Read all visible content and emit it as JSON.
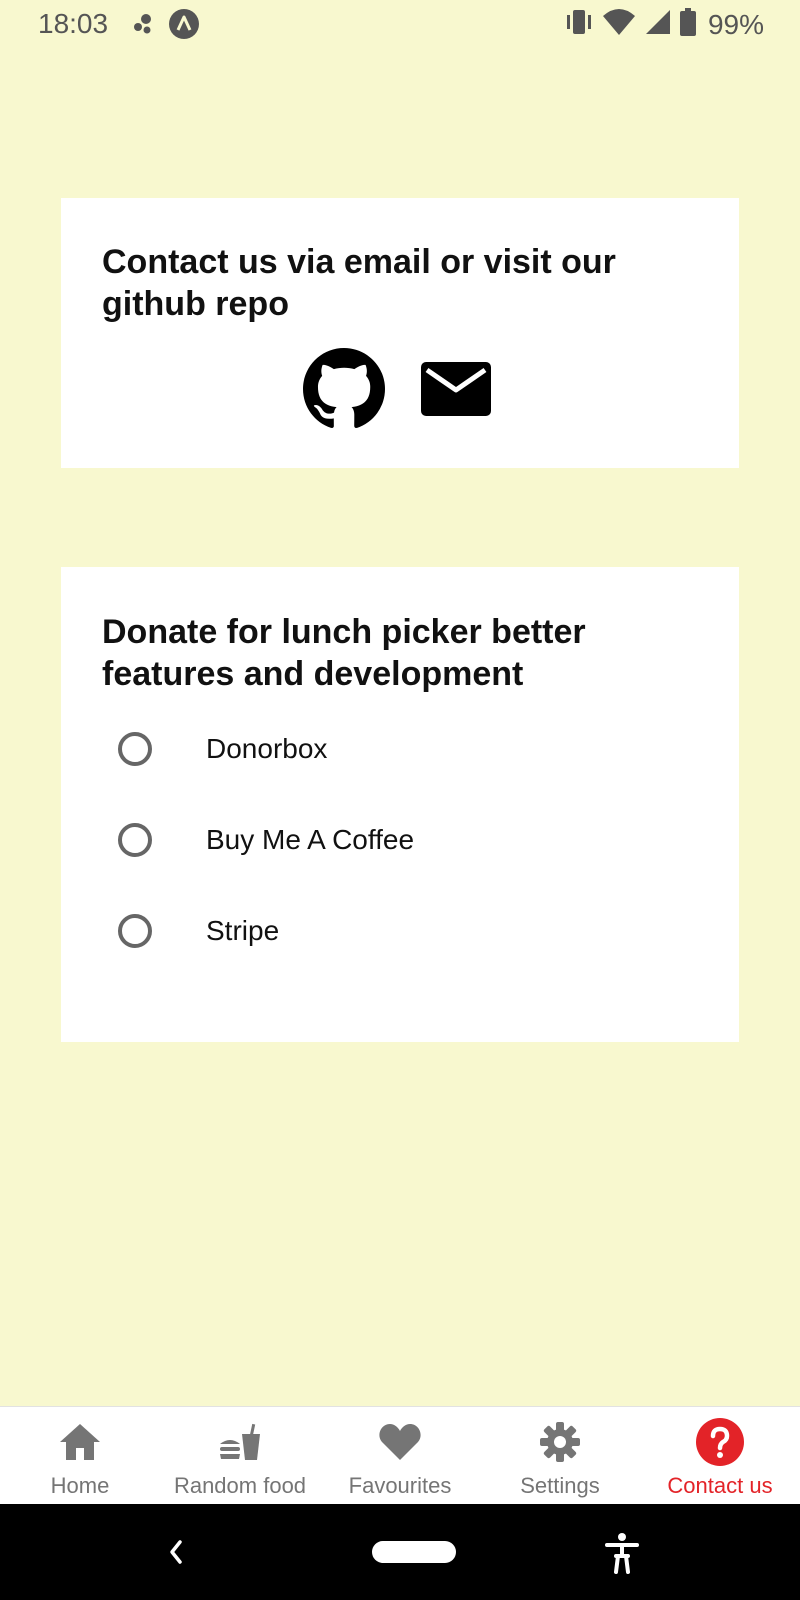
{
  "status_bar": {
    "time": "18:03",
    "battery": "99%",
    "icons": [
      "notification-dots-icon",
      "app-a-icon",
      "vibrate-icon",
      "wifi-icon",
      "signal-icon",
      "battery-icon"
    ]
  },
  "contact_card": {
    "title": "Contact us via email or visit our github repo",
    "icons": [
      "github-icon",
      "email-icon"
    ]
  },
  "donate_card": {
    "title": "Donate for lunch picker better features and development",
    "options": [
      "Donorbox",
      "Buy Me A Coffee",
      "Stripe"
    ]
  },
  "bottom_nav": {
    "items": [
      {
        "label": "Home",
        "icon": "home-icon"
      },
      {
        "label": "Random food",
        "icon": "fastfood-icon"
      },
      {
        "label": "Favourites",
        "icon": "heart-icon"
      },
      {
        "label": "Settings",
        "icon": "gear-icon"
      },
      {
        "label": "Contact us",
        "icon": "help-icon"
      }
    ],
    "active_index": 4,
    "active_color": "#e32328",
    "inactive_color": "#757575"
  },
  "colors": {
    "background": "#f8f8cf",
    "card": "#ffffff"
  }
}
